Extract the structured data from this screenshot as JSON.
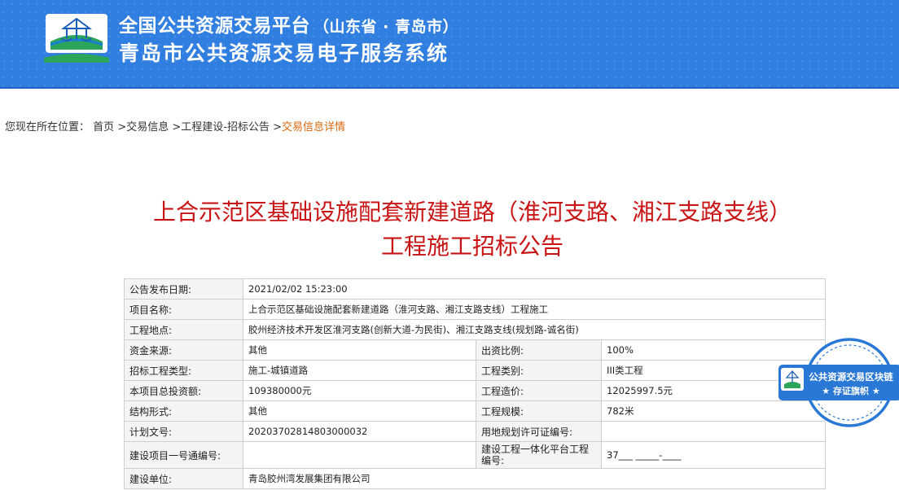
{
  "header": {
    "title_main": "全国公共资源交易平台",
    "title_region": "（山东省 · 青岛市）",
    "title_sub": "青岛市公共资源交易电子服务系统"
  },
  "breadcrumb": {
    "prefix": "您现在所在位置：",
    "home": "首页",
    "sep1": " >",
    "level1": "交易信息",
    "sep2": " >",
    "level2": "工程建设-招标公告",
    "sep3": " >",
    "current": "交易信息详情"
  },
  "page_title": {
    "line1": "上合示范区基础设施配套新建道路（淮河支路、湘江支路支线）",
    "line2": "工程施工招标公告"
  },
  "table": {
    "publish_date_label": "公告发布日期:",
    "publish_date": "2021/02/02 15:23:00",
    "project_name_label": "项目名称:",
    "project_name": "上合示范区基础设施配套新建道路（淮河支路、湘江支路支线）工程施工",
    "location_label": "工程地点:",
    "location": "胶州经济技术开发区淮河支路(创新大道-为民街)、湘江支路支线(规划路-诚名街)",
    "fund_source_label": "资金来源:",
    "fund_source": "其他",
    "fund_ratio_label": "出资比例:",
    "fund_ratio": "100%",
    "bid_type_label": "招标工程类型:",
    "bid_type": "施工-城镇道路",
    "project_category_label": "工程类别:",
    "project_category": "III类工程",
    "total_investment_label": "本项目总投资额:",
    "total_investment": "109380000元",
    "cost_label": "工程造价:",
    "cost": "12025997.5元",
    "structure_label": "结构形式:",
    "structure": "其他",
    "scale_label": "工程规模:",
    "scale": "782米",
    "plan_doc_label": "计划文号:",
    "plan_doc": "20203702814803000032",
    "land_permit_label": "用地规划许可证编号:",
    "land_permit": "",
    "project_code_label": "建设项目一号通编号:",
    "project_code": "",
    "platform_code_label": "建设工程一体化平台工程编号:",
    "platform_code": "37___ _____-____",
    "builder_label": "建设单位:",
    "builder": "青岛胶州湾发展集团有限公司"
  },
  "stamp": {
    "line1": "公共资源交易区块链",
    "line2": "★ 存证旗帜 ★"
  },
  "colors": {
    "header_bg": "#2f7ee0",
    "title_red": "#c81414",
    "breadcrumb_current": "#d8680c",
    "stamp_blue": "#2a78d6"
  }
}
